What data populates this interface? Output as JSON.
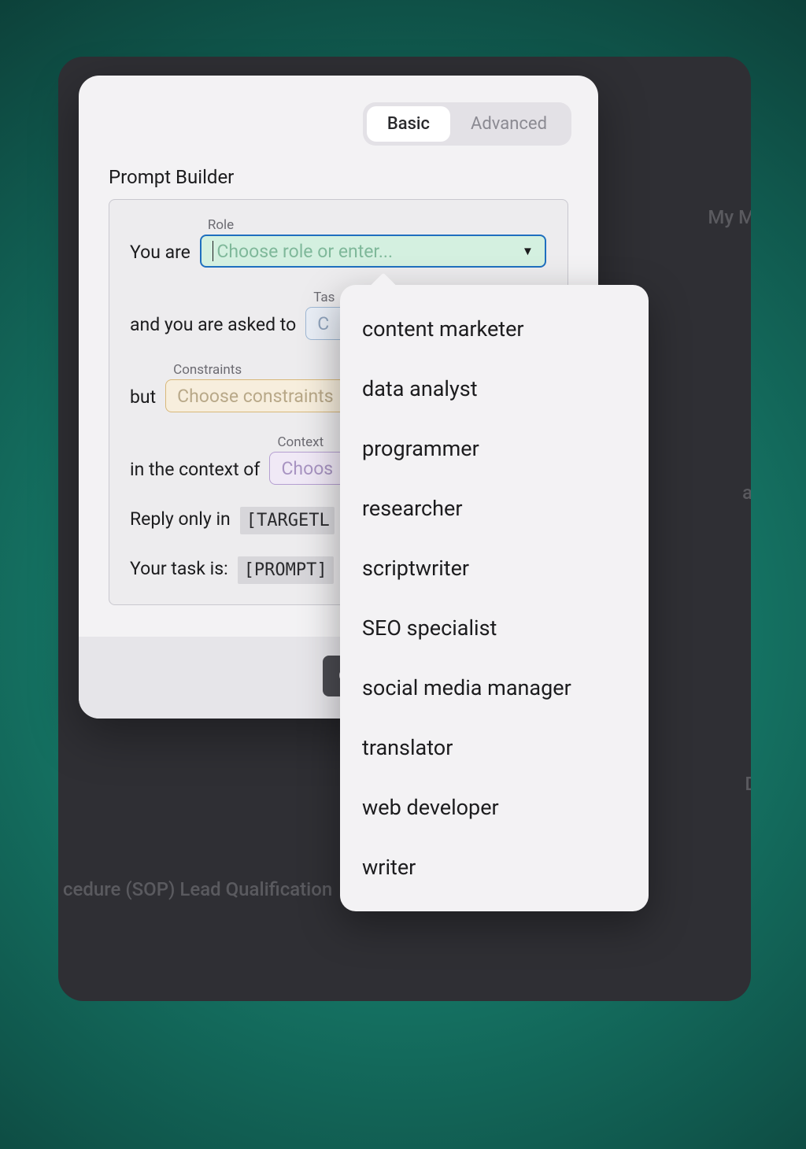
{
  "tabs": {
    "basic": "Basic",
    "advanced": "Advanced"
  },
  "title": "Prompt Builder",
  "builder": {
    "you_are": "You are",
    "role_label": "Role",
    "role_placeholder": "Choose role or enter...",
    "asked_to": "and you are asked to",
    "task_label": "Task",
    "task_placeholder": "C",
    "but": "but",
    "constraints_label": "Constraints",
    "constraints_placeholder": "Choose constraints",
    "context_of": "in the context of",
    "context_label": "Context",
    "context_placeholder": "Choos",
    "reply_only": "Reply only in",
    "target_token": "[TARGETL",
    "your_task": "Your task is:",
    "prompt_token": "[PROMPT]"
  },
  "footer": {
    "button_fragment": "C"
  },
  "dropdown": {
    "options": [
      "content marketer",
      "data analyst",
      "programmer",
      "researcher",
      "scriptwriter",
      "SEO specialist",
      "social media manager",
      "translator",
      "web developer",
      "writer"
    ]
  },
  "background": {
    "frag1": "My Ma",
    "frag2": "at",
    "frag3": "D",
    "frag4": "cedure (SOP) Lead Qualification"
  }
}
